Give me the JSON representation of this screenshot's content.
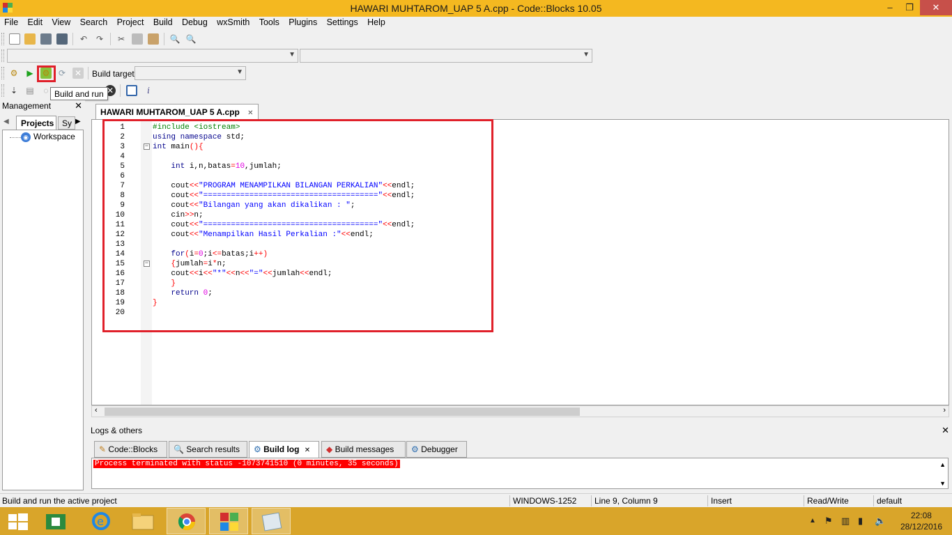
{
  "window": {
    "title": "HAWARI MUHTAROM_UAP 5 A.cpp - Code::Blocks 10.05",
    "minimize": "–",
    "maximize": "❐",
    "close": "✕"
  },
  "menu": [
    "File",
    "Edit",
    "View",
    "Search",
    "Project",
    "Build",
    "Debug",
    "wxSmith",
    "Tools",
    "Plugins",
    "Settings",
    "Help"
  ],
  "build_toolbar": {
    "build_target_label": "Build target:",
    "build_target_value": ""
  },
  "tooltip": "Build and run",
  "management": {
    "title": "Management",
    "close": "✕",
    "tabs": [
      "Projects",
      "Sy"
    ],
    "tree": [
      "Workspace"
    ]
  },
  "editor": {
    "tab_label": "HAWARI MUHTAROM_UAP 5 A.cpp",
    "tab_close": "✕"
  },
  "logs": {
    "title": "Logs & others",
    "close": "✕",
    "tabs": [
      "Code::Blocks",
      "Search results",
      "Build log",
      "Build messages",
      "Debugger"
    ],
    "active_tab": "Build log",
    "message": "Process terminated with status -1073741510 (0 minutes, 35 seconds)"
  },
  "statusbar": {
    "message": "Build and run the active project",
    "encoding": "WINDOWS-1252",
    "position": "Line 9, Column 9",
    "mode": "Insert",
    "access": "Read/Write",
    "profile": "default"
  },
  "taskbar": {
    "time": "22:08",
    "date": "28/12/2016"
  },
  "colors": {
    "titlebar": "#f4b820",
    "taskbar": "#d9a52a",
    "highlight": "#e0202a",
    "keyword": "#00008b",
    "preprocessor": "#008000",
    "string": "#0000ff",
    "number": "#e000e0",
    "operator": "#ff0000"
  }
}
